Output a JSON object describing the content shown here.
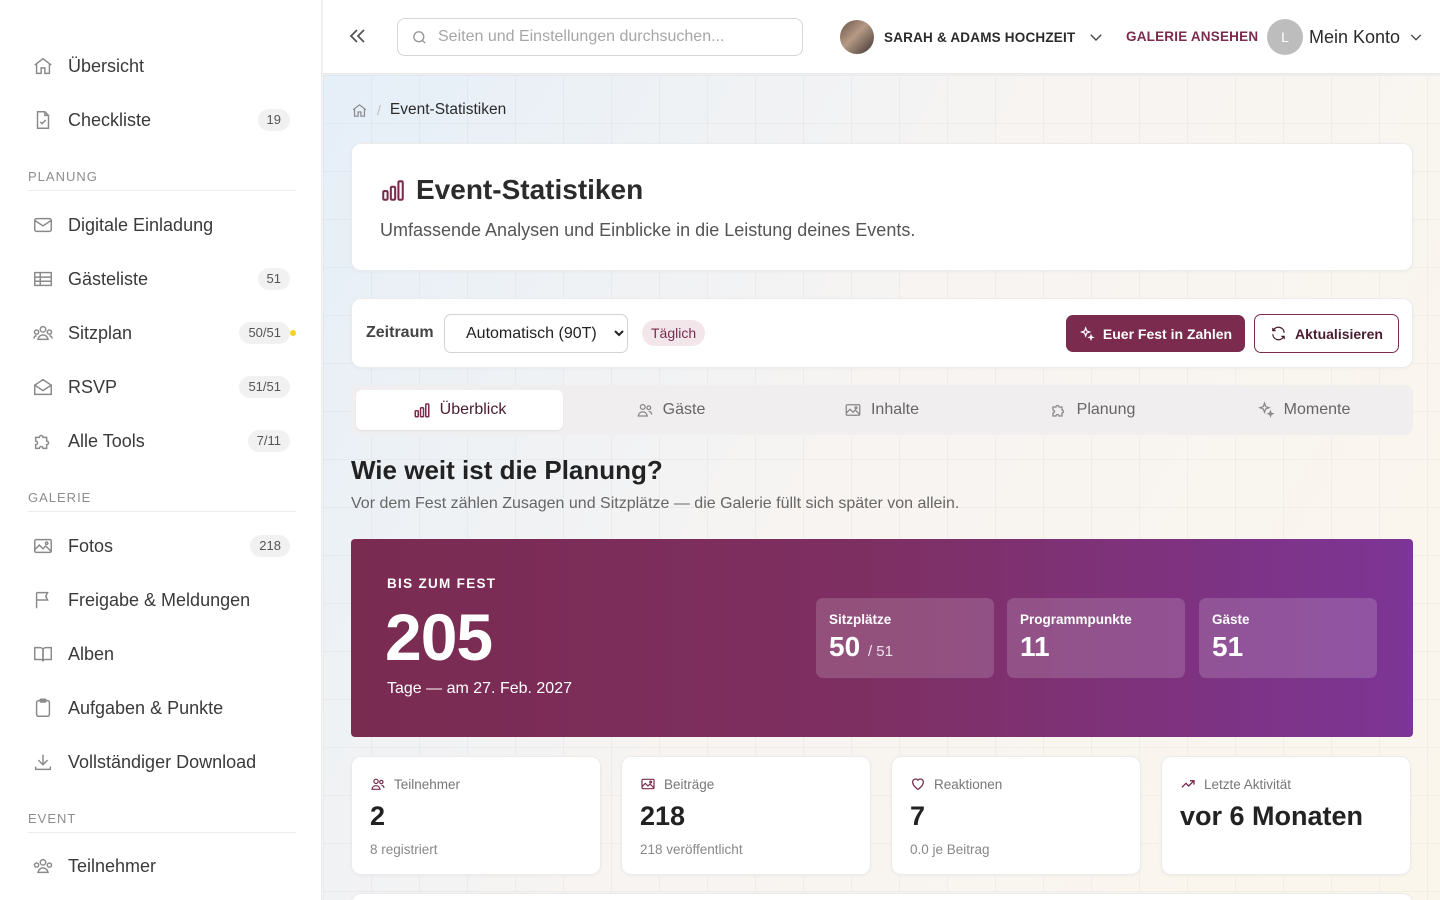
{
  "sidebar": {
    "items": [
      {
        "label": "Übersicht",
        "badge": null
      },
      {
        "label": "Checkliste",
        "badge": "19"
      }
    ],
    "sections": [
      {
        "title": "PLANUNG",
        "items": [
          {
            "label": "Digitale Einladung",
            "badge": null
          },
          {
            "label": "Gästeliste",
            "badge": "51"
          },
          {
            "label": "Sitzplan",
            "badge": "50/51"
          },
          {
            "label": "RSVP",
            "badge": "51/51"
          },
          {
            "label": "Alle Tools",
            "badge": "7/11"
          }
        ]
      },
      {
        "title": "GALERIE",
        "items": [
          {
            "label": "Fotos",
            "badge": "218"
          },
          {
            "label": "Freigabe & Meldungen",
            "badge": null
          },
          {
            "label": "Alben",
            "badge": null
          },
          {
            "label": "Aufgaben & Punkte",
            "badge": null
          },
          {
            "label": "Vollständiger Download",
            "badge": null
          }
        ]
      },
      {
        "title": "EVENT",
        "items": [
          {
            "label": "Teilnehmer",
            "badge": null
          }
        ]
      }
    ]
  },
  "topbar": {
    "search_placeholder": "Seiten und Einstellungen durchsuchen...",
    "event_name": "SARAH & ADAMS HOCHZEIT",
    "gallery_link": "GALERIE ANSEHEN",
    "account_initial": "L",
    "account_label": "Mein Konto"
  },
  "breadcrumb": {
    "current": "Event-Statistiken"
  },
  "header": {
    "title": "Event-Statistiken",
    "subtitle": "Umfassende Analysen und Einblicke in die Leistung deines Events."
  },
  "toolbar": {
    "period_label": "Zeitraum",
    "period_options": [
      "Automatisch (90T)"
    ],
    "period_selected": "Automatisch (90T)",
    "frequency_badge": "Täglich",
    "primary_button": "Euer Fest in Zahlen",
    "refresh_button": "Aktualisieren"
  },
  "tabs": [
    {
      "label": "Überblick",
      "icon": "bar-chart-icon",
      "active": true
    },
    {
      "label": "Gäste",
      "icon": "users-icon",
      "active": false
    },
    {
      "label": "Inhalte",
      "icon": "image-icon",
      "active": false
    },
    {
      "label": "Planung",
      "icon": "puzzle-icon",
      "active": false
    },
    {
      "label": "Momente",
      "icon": "sparkles-icon",
      "active": false
    }
  ],
  "overview": {
    "heading": "Wie weit ist die Planung?",
    "subheading": "Vor dem Fest zählen Zusagen und Sitzplätze — die Galerie füllt sich später von allein.",
    "countdown": {
      "eyebrow": "BIS ZUM FEST",
      "days": "205",
      "caption": "Tage — am 27. Feb. 2027"
    },
    "hero_stats": [
      {
        "label": "Sitzplätze",
        "value": "50",
        "total": "/ 51"
      },
      {
        "label": "Programmpunkte",
        "value": "11",
        "total": ""
      },
      {
        "label": "Gäste",
        "value": "51",
        "total": ""
      }
    ],
    "kpis": [
      {
        "label": "Teilnehmer",
        "icon": "users-icon",
        "value": "2",
        "sub": "8 registriert"
      },
      {
        "label": "Beiträge",
        "icon": "image-icon",
        "value": "218",
        "sub": "218 veröffentlicht"
      },
      {
        "label": "Reaktionen",
        "icon": "heart-icon",
        "value": "7",
        "sub": "0.0 je Beitrag"
      },
      {
        "label": "Letzte Aktivität",
        "icon": "trending-up-icon",
        "value": "vor 6 Monaten",
        "sub": ""
      }
    ]
  },
  "colors": {
    "accent": "#7a2b4e",
    "hero_gradient_start": "#7a2b50",
    "hero_gradient_end": "#7d3596",
    "status_dot": "#f2d326"
  }
}
